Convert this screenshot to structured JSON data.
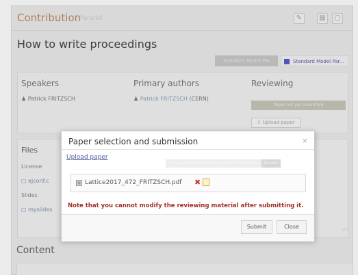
{
  "header": {
    "title": "Contribution",
    "subtitle": "Parallel"
  },
  "contribution": {
    "title": "How to write proceedings",
    "tags": [
      "Standard Model Par...",
      "Standard Model Par..."
    ]
  },
  "speakers": {
    "label": "Speakers",
    "name": "Patrick FRITZSCH"
  },
  "primary_authors": {
    "label": "Primary authors",
    "name": "Patrick FRITZSCH",
    "affiliation": "(CERN)"
  },
  "reviewing": {
    "label": "Reviewing",
    "status_button": "Paper not yet submitted",
    "upload_button": "Upload paper"
  },
  "files": {
    "label": "Files",
    "license_label": "License",
    "license_item": "ejconf.c",
    "slides_label": "Slides",
    "slides_item": "myslides"
  },
  "content": {
    "label": "Content"
  },
  "dialog": {
    "title": "Paper selection and submission",
    "close": "×",
    "upload_link": "Upload paper",
    "drop_hint": "Drag and drop files here or click to browse",
    "drop_hint_end": "Browse",
    "file_name": "Lattice2017_472_FRITZSCH.pdf",
    "warning": "Note that you cannot modify the reviewing material after submitting it.",
    "submit": "Submit",
    "close_button": "Close"
  },
  "colors": {
    "accent": "#b88d67",
    "link": "#4f5f9f",
    "warning": "#a03028",
    "remove": "#d23030",
    "tag_accent": "#5a5ac8"
  },
  "icons": {
    "edit": "pencil-icon",
    "header2": "document-icon",
    "header3": "window-icon",
    "person": "person-icon",
    "file": "file-icon",
    "pdf": "pdf-icon",
    "remove": "remove-x-icon",
    "edit_file": "edit-note-icon"
  }
}
